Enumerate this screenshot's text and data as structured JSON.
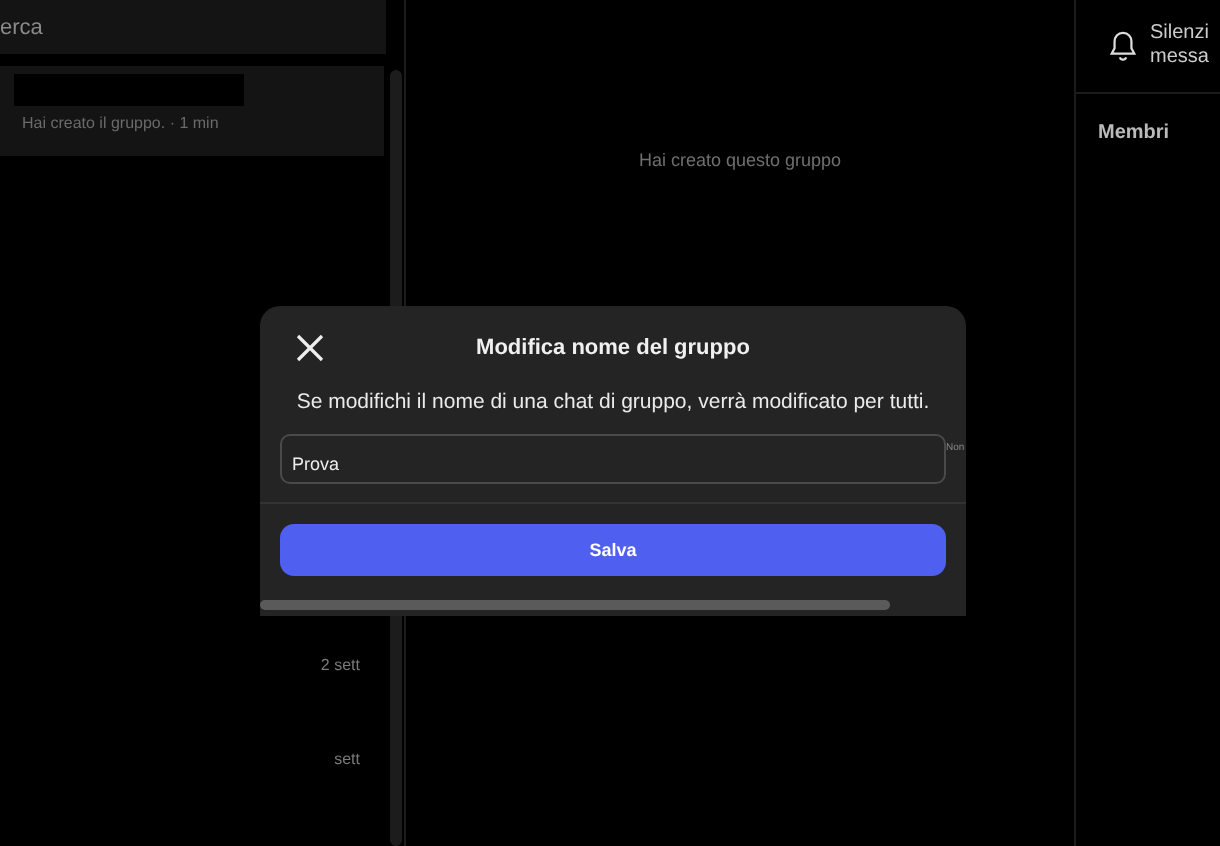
{
  "sidebar": {
    "search": {
      "placeholder": "erca"
    },
    "chats": [
      {
        "preview": "Hai creato il gruppo. · 1 min",
        "selected": true
      }
    ],
    "times": [
      "2 sett",
      "sett"
    ]
  },
  "conversation": {
    "notice": "Hai creato questo gruppo"
  },
  "details": {
    "mute_label": [
      "Silenzi",
      "messa"
    ],
    "members_heading": "Membri"
  },
  "dialog": {
    "title": "Modifica nome del gruppo",
    "message": "Se modifichi il nome di una chat di gruppo, verrà modificato per tutti.",
    "name_field": {
      "value": "Prova"
    },
    "side_label": "Non",
    "button": "Salva"
  }
}
